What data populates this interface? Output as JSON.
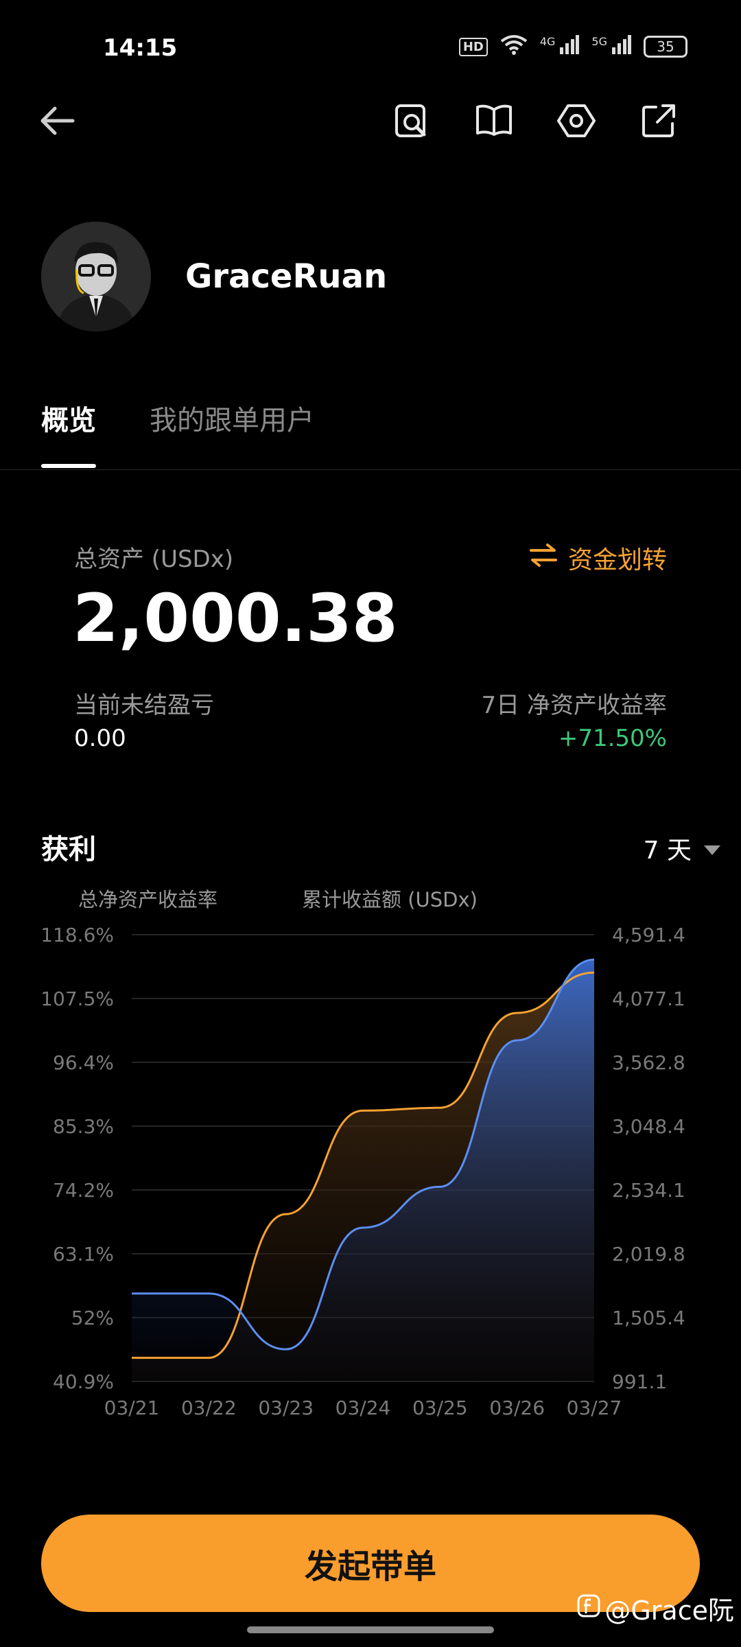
{
  "status_bar": {
    "time": "14:15",
    "hd_label": "HD",
    "net1": "4G",
    "net2": "5G",
    "battery": "35"
  },
  "top_icons": [
    "back-arrow-icon",
    "search-document-icon",
    "book-icon",
    "settings-hex-icon",
    "share-icon"
  ],
  "profile": {
    "username": "GraceRuan"
  },
  "tabs": [
    {
      "label": "概览",
      "active": true
    },
    {
      "label": "我的跟单用户",
      "active": false
    }
  ],
  "assets": {
    "total_label": "总资产 (USDx)",
    "total_value": "2,000.38",
    "transfer_label": "资金划转",
    "unrealized_label": "当前未结盈亏",
    "unrealized_value": "0.00",
    "roi_label": "7日 净资产收益率",
    "roi_value": "+71.50%"
  },
  "profit": {
    "title": "获利",
    "period": "7 天",
    "legend_left": "总净资产收益率",
    "legend_right": "累计收益额 (USDx)"
  },
  "colors": {
    "accent": "#f99d2d",
    "green": "#3ec87a",
    "orange_line": "#f6a233",
    "blue_line": "#5b8ef0"
  },
  "chart_data": {
    "type": "line",
    "x": [
      "03/21",
      "03/22",
      "03/23",
      "03/24",
      "03/25",
      "03/26",
      "03/27"
    ],
    "left_axis_ticks": [
      "118.6%",
      "107.5%",
      "96.4%",
      "85.3%",
      "74.2%",
      "63.1%",
      "52%",
      "40.9%"
    ],
    "right_axis_ticks": [
      "4,591.4",
      "4,077.1",
      "3,562.8",
      "3,048.4",
      "2,534.1",
      "2,019.8",
      "1,505.4",
      "991.1"
    ],
    "ylim_left": [
      40.9,
      118.6
    ],
    "ylim_right": [
      991.1,
      4591.4
    ],
    "series": [
      {
        "name": "总净资产收益率",
        "axis": "left",
        "color": "#f6a233",
        "values": [
          45.0,
          45.0,
          70.0,
          88.0,
          88.5,
          105.0,
          112.0
        ]
      },
      {
        "name": "累计收益额 (USDx)",
        "axis": "right",
        "color": "#5b8ef0",
        "values": [
          1700,
          1700,
          1250,
          2230,
          2560,
          3740,
          4390
        ]
      }
    ],
    "grid": true
  },
  "cta_label": "发起带单",
  "watermark": "@Grace阮"
}
